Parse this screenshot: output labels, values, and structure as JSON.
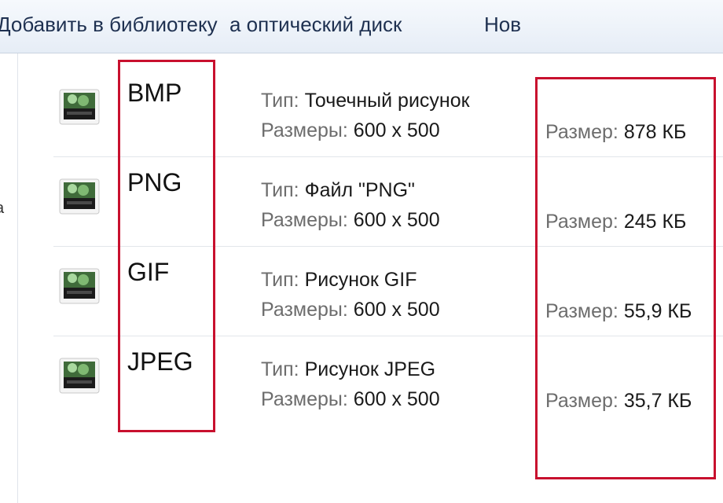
{
  "toolbar": {
    "add_to_library": "Добавить в библиотеку",
    "burn_disc": "а оптический диск",
    "new": "Нов"
  },
  "nav": {
    "edge_glyph": "а"
  },
  "labels": {
    "type": "Тип: ",
    "dimensions": "Размеры: ",
    "size": "Размер: "
  },
  "files": [
    {
      "name": "BMP",
      "type": "Точечный рисунок",
      "dimensions": "600 x 500",
      "size": "878 КБ",
      "icon": "image-file-icon"
    },
    {
      "name": "PNG",
      "type": "Файл \"PNG\"",
      "dimensions": "600 x 500",
      "size": "245 КБ",
      "icon": "image-file-icon"
    },
    {
      "name": "GIF",
      "type": "Рисунок GIF",
      "dimensions": "600 x 500",
      "size": "55,9 КБ",
      "icon": "image-file-icon"
    },
    {
      "name": "JPEG",
      "type": "Рисунок JPEG",
      "dimensions": "600 x 500",
      "size": "35,7 КБ",
      "icon": "image-file-icon"
    }
  ],
  "colors": {
    "highlight": "#c8102e",
    "toolbar_text": "#1e3050",
    "label_gray": "#6d6d6d"
  }
}
